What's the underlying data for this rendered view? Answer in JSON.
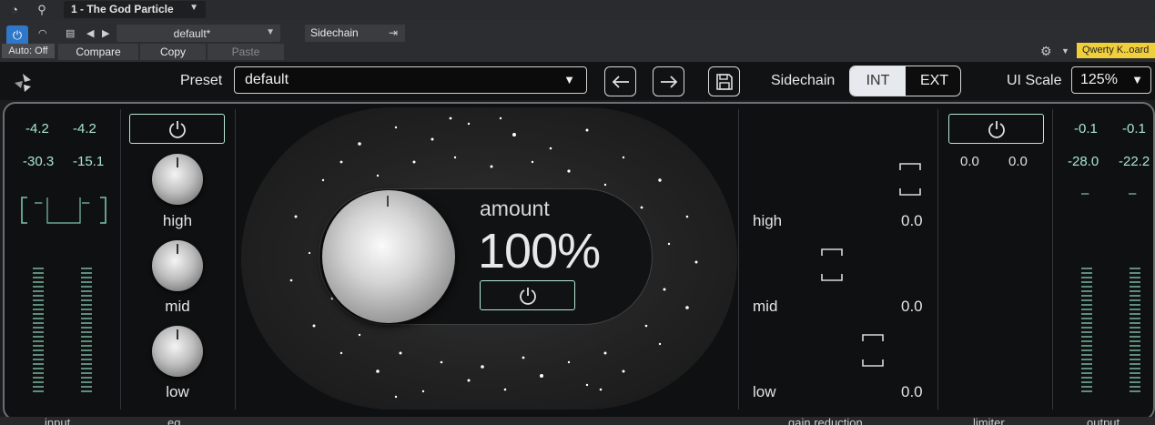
{
  "host": {
    "track_name": "1 - The God Particle",
    "auto_label": "Auto: Off",
    "preset": "default*",
    "compare_label": "Compare",
    "copy_label": "Copy",
    "paste_label": "Paste",
    "sidechain_label": "Sidechain",
    "midi_device": "Qwerty K..oard"
  },
  "toolbar": {
    "preset_label": "Preset",
    "preset_value": "default",
    "sidechain_label": "Sidechain",
    "sidechain_options": [
      "INT",
      "EXT"
    ],
    "sidechain_selected": "INT",
    "ui_scale_label": "UI Scale",
    "ui_scale_value": "125%"
  },
  "input": {
    "peak_l": "-4.2",
    "peak_r": "-4.2",
    "rms_l": "-30.3",
    "rms_r": "-15.1",
    "link_symbol": "–",
    "link_symbol_r": "–"
  },
  "eq": {
    "bands": [
      "high",
      "mid",
      "low"
    ]
  },
  "amount": {
    "label": "amount",
    "value": "100%"
  },
  "gain_reduction": {
    "bands": [
      {
        "name": "high",
        "value": "0.0"
      },
      {
        "name": "mid",
        "value": "0.0"
      },
      {
        "name": "low",
        "value": "0.0"
      }
    ]
  },
  "limiter": {
    "value_l": "0.0",
    "value_r": "0.0"
  },
  "output": {
    "peak_l": "-0.1",
    "peak_r": "-0.1",
    "rms_l": "-28.0",
    "rms_r": "-22.2",
    "dash_l": "–",
    "dash_r": "–"
  },
  "footer": {
    "labels": [
      "input",
      "eq",
      "gain reduction",
      "limiter",
      "output"
    ]
  },
  "colors": {
    "accent_teal": "#a7e6cd",
    "host_blue": "#2f78c9",
    "midi_yellow": "#f0cf3a"
  }
}
